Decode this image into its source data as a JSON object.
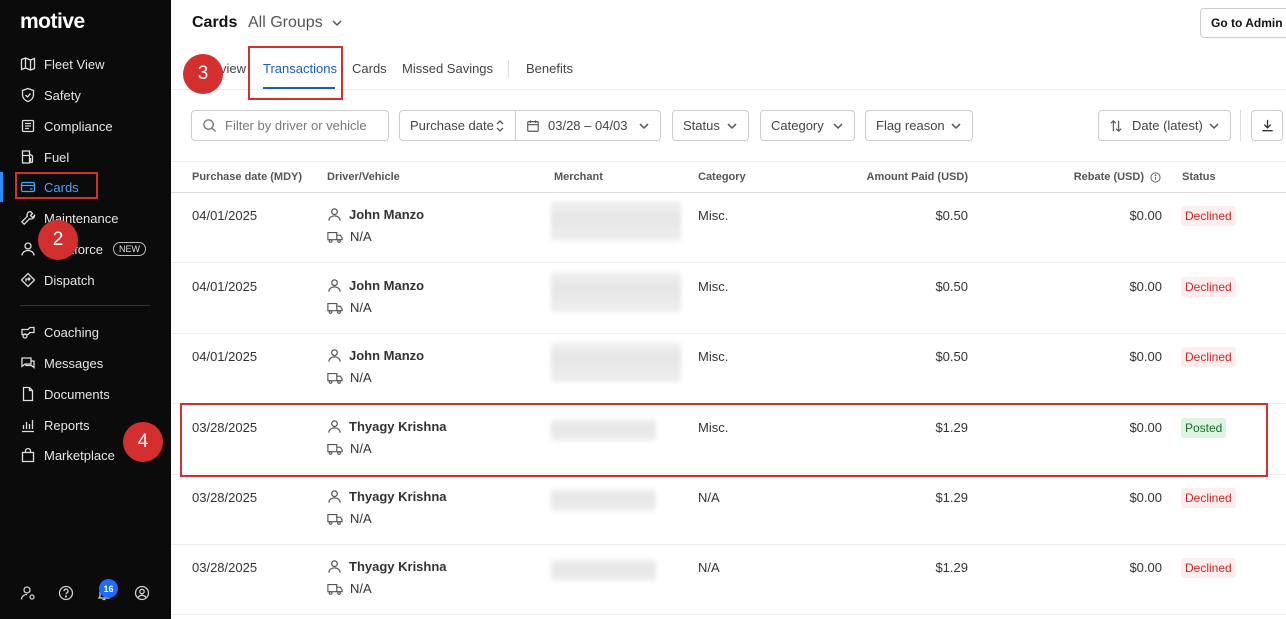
{
  "sidebar": {
    "logo": "motive",
    "items": [
      {
        "label": "Fleet View",
        "icon": "map-icon"
      },
      {
        "label": "Safety",
        "icon": "shield-icon"
      },
      {
        "label": "Compliance",
        "icon": "clipboard-icon"
      },
      {
        "label": "Fuel",
        "icon": "fuel-icon"
      },
      {
        "label": "Cards",
        "icon": "card-icon"
      },
      {
        "label": "Maintenance",
        "icon": "wrench-icon"
      },
      {
        "label": "Workforce",
        "icon": "person-icon",
        "badge": "NEW"
      },
      {
        "label": "Dispatch",
        "icon": "dispatch-icon"
      },
      {
        "label": "Coaching",
        "icon": "coaching-icon"
      },
      {
        "label": "Messages",
        "icon": "message-icon"
      },
      {
        "label": "Documents",
        "icon": "document-icon"
      },
      {
        "label": "Reports",
        "icon": "reports-icon"
      },
      {
        "label": "Marketplace",
        "icon": "bag-icon"
      }
    ],
    "notification_count": "16"
  },
  "header": {
    "title": "Cards",
    "group": "All Groups",
    "admin_button": "Go to Admin"
  },
  "tabs": [
    {
      "label": "Overview"
    },
    {
      "label": "Transactions"
    },
    {
      "label": "Cards"
    },
    {
      "label": "Missed Savings"
    },
    {
      "label": "Benefits"
    }
  ],
  "filters": {
    "search_placeholder": "Filter by driver or vehicle",
    "purchase_date": "Purchase date",
    "date_range": "03/28 – 04/03",
    "status": "Status",
    "category": "Category",
    "flag_reason": "Flag reason",
    "sort": "Date (latest)"
  },
  "table": {
    "columns": [
      "Purchase date (MDY)",
      "Driver/Vehicle",
      "Merchant",
      "Category",
      "Amount Paid (USD)",
      "Rebate (USD)",
      "Status"
    ],
    "rows": [
      {
        "date": "04/01/2025",
        "driver": "John Manzo",
        "vehicle": "N/A",
        "category": "Misc.",
        "amount": "$0.50",
        "rebate": "$0.00",
        "status": "Declined"
      },
      {
        "date": "04/01/2025",
        "driver": "John Manzo",
        "vehicle": "N/A",
        "category": "Misc.",
        "amount": "$0.50",
        "rebate": "$0.00",
        "status": "Declined"
      },
      {
        "date": "04/01/2025",
        "driver": "John Manzo",
        "vehicle": "N/A",
        "category": "Misc.",
        "amount": "$0.50",
        "rebate": "$0.00",
        "status": "Declined"
      },
      {
        "date": "03/28/2025",
        "driver": "Thyagy Krishna",
        "vehicle": "N/A",
        "category": "Misc.",
        "amount": "$1.29",
        "rebate": "$0.00",
        "status": "Posted"
      },
      {
        "date": "03/28/2025",
        "driver": "Thyagy Krishna",
        "vehicle": "N/A",
        "category": "N/A",
        "amount": "$1.29",
        "rebate": "$0.00",
        "status": "Declined"
      },
      {
        "date": "03/28/2025",
        "driver": "Thyagy Krishna",
        "vehicle": "N/A",
        "category": "N/A",
        "amount": "$1.29",
        "rebate": "$0.00",
        "status": "Declined"
      }
    ]
  },
  "annotations": {
    "step2": "2",
    "step3": "3",
    "step4": "4",
    "color": "#d32f2f"
  }
}
